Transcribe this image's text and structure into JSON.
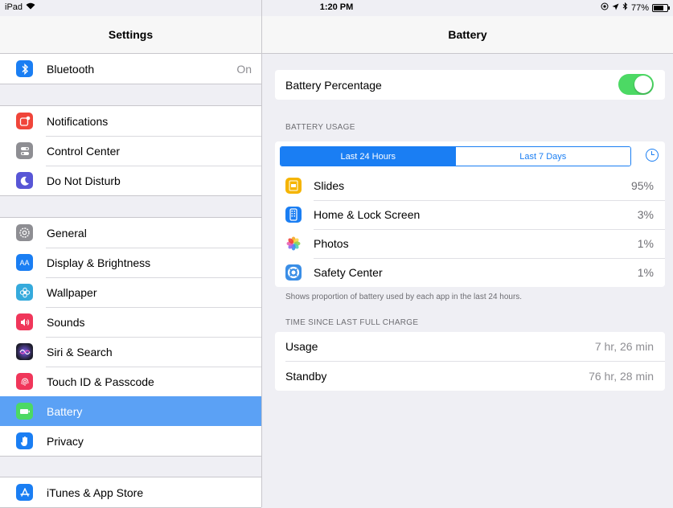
{
  "status_bar": {
    "device": "iPad",
    "time": "1:20 PM",
    "battery_percent": "77%",
    "battery_level": 0.77,
    "icons": [
      "wifi-icon",
      "location-icon",
      "bluetooth-icon",
      "battery-icon"
    ]
  },
  "sidebar": {
    "title": "Settings",
    "groups": [
      {
        "items": [
          {
            "label": "Bluetooth",
            "value": "On",
            "icon": "bluetooth-icon",
            "color": "#1a7ef3"
          }
        ]
      },
      {
        "items": [
          {
            "label": "Notifications",
            "icon": "notifications-icon",
            "color": "#f0453a"
          },
          {
            "label": "Control Center",
            "icon": "control-center-icon",
            "color": "#8e8e93"
          },
          {
            "label": "Do Not Disturb",
            "icon": "moon-icon",
            "color": "#5856d6"
          }
        ]
      },
      {
        "items": [
          {
            "label": "General",
            "icon": "gear-icon",
            "color": "#8e8e93"
          },
          {
            "label": "Display & Brightness",
            "icon": "display-icon",
            "color": "#1a7ef3"
          },
          {
            "label": "Wallpaper",
            "icon": "wallpaper-icon",
            "color": "#35aadc"
          },
          {
            "label": "Sounds",
            "icon": "sounds-icon",
            "color": "#f0365a"
          },
          {
            "label": "Siri & Search",
            "icon": "siri-icon",
            "color": "#2b2b3d"
          },
          {
            "label": "Touch ID & Passcode",
            "icon": "fingerprint-icon",
            "color": "#f0365a"
          },
          {
            "label": "Battery",
            "icon": "battery-icon",
            "color": "#4cd964",
            "selected": true
          },
          {
            "label": "Privacy",
            "icon": "hand-icon",
            "color": "#1a7ef3"
          }
        ]
      },
      {
        "items": [
          {
            "label": "iTunes & App Store",
            "icon": "app-store-icon",
            "color": "#1a7ef3"
          }
        ]
      }
    ]
  },
  "main": {
    "title": "Battery",
    "battery_percentage": {
      "label": "Battery Percentage",
      "on": true
    },
    "usage_header": "BATTERY USAGE",
    "segments": {
      "active": "Last 24 Hours",
      "inactive": "Last 7 Days"
    },
    "apps": [
      {
        "name": "Slides",
        "percent": "95%",
        "icon": "slides-icon",
        "color": "#f5b400"
      },
      {
        "name": "Home & Lock Screen",
        "percent": "3%",
        "icon": "home-lock-icon",
        "color": "#1a7ef3"
      },
      {
        "name": "Photos",
        "percent": "1%",
        "icon": "photos-icon",
        "color": "#ffffff"
      },
      {
        "name": "Safety Center",
        "percent": "1%",
        "icon": "safety-center-icon",
        "color": "#3a8ee6"
      }
    ],
    "usage_note": "Shows proportion of battery used by each app in the last 24 hours.",
    "charge_header": "TIME SINCE LAST FULL CHARGE",
    "charge": [
      {
        "label": "Usage",
        "value": "7 hr, 26 min"
      },
      {
        "label": "Standby",
        "value": "76 hr, 28 min"
      }
    ]
  }
}
